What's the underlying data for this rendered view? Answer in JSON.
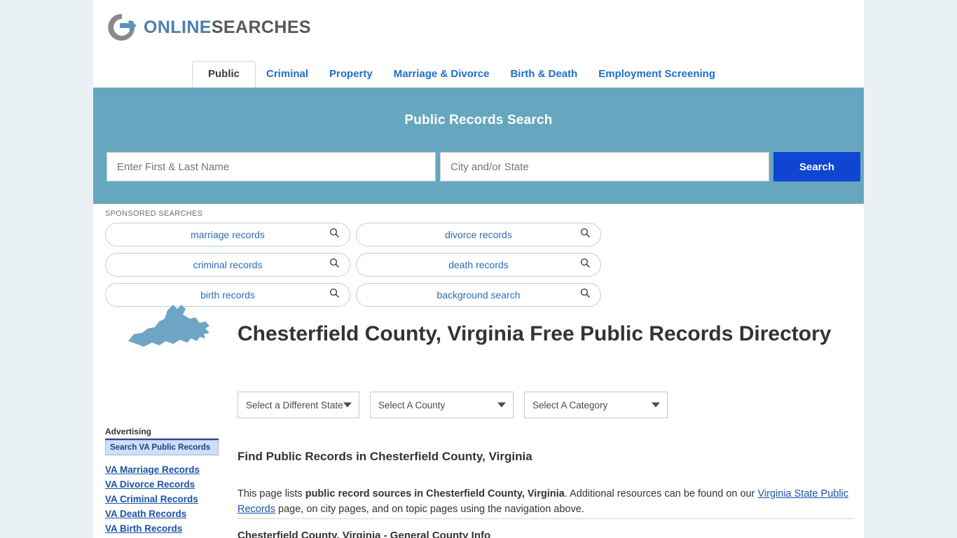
{
  "logo": {
    "part1": "ONLINE",
    "part2": "SEARCHES",
    "icon": "circle-arrow-icon"
  },
  "nav": {
    "tabs": [
      {
        "label": "Public",
        "active": true
      },
      {
        "label": "Criminal",
        "active": false
      },
      {
        "label": "Property",
        "active": false
      },
      {
        "label": "Marriage & Divorce",
        "active": false
      },
      {
        "label": "Birth & Death",
        "active": false
      },
      {
        "label": "Employment Screening",
        "active": false
      }
    ]
  },
  "banner": {
    "title": "Public Records Search",
    "name_placeholder": "Enter First & Last Name",
    "name_value": "",
    "city_placeholder": "City and/or State",
    "city_value": "",
    "search_label": "Search",
    "bg_color": "#66a7bf",
    "button_color": "#1045d4"
  },
  "sponsored": {
    "label": "SPONSORED SEARCHES",
    "chips": [
      "marriage records",
      "divorce records",
      "criminal records",
      "death records",
      "birth records",
      "background search"
    ]
  },
  "page": {
    "title": "Chesterfield County, Virginia Free Public Records Directory",
    "state_map_alt": "virginia-state-map"
  },
  "selects": [
    {
      "name": "state",
      "value": "Select a Different State"
    },
    {
      "name": "county",
      "value": "Select A County"
    },
    {
      "name": "category",
      "value": "Select A Category"
    }
  ],
  "content": {
    "find_heading": "Find Public Records in Chesterfield County, Virginia",
    "para_1": "This page lists ",
    "para_bold": "public record sources in Chesterfield County, Virginia",
    "para_2": ". Additional resources can be found on our ",
    "para_link": "Virginia State Public Records",
    "para_3": " page, on city pages, and on topic pages using the navigation above.",
    "section_subheading": "Chesterfield County, Virginia - General County Info"
  },
  "sidebar": {
    "advertising_label": "Advertising",
    "ad_box_label": "Search VA Public Records",
    "links": [
      "VA Marriage Records",
      "VA Divorce Records",
      "VA Criminal Records",
      "VA Death Records",
      "VA Birth Records"
    ]
  }
}
